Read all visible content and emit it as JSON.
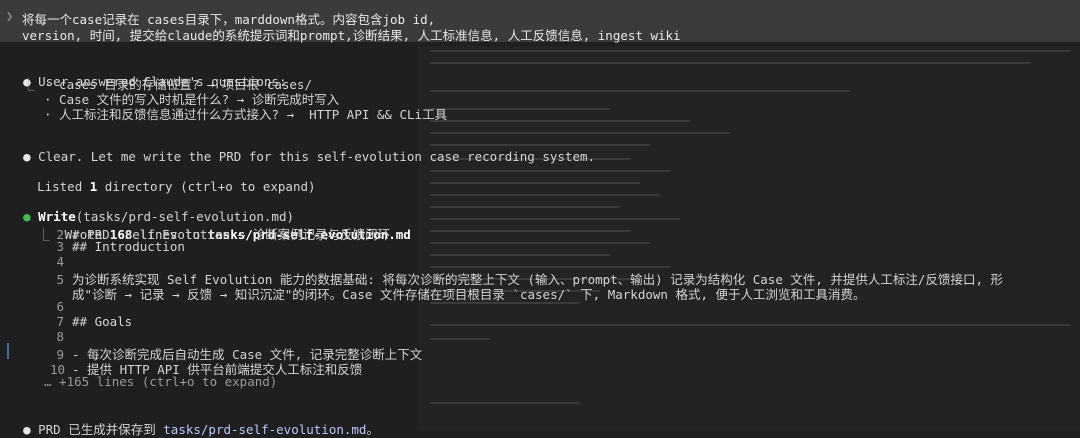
{
  "prompt": {
    "line1": "将每一个case记录在 cases目录下，marddown格式。内容包含job id,",
    "line2": "version, 时间, 提交给claude的系统提示词和prompt,诊断结果, 人工标准信息, 人工反馈信息, ingest wiki"
  },
  "questions": {
    "header": "User answered Claude's questions:",
    "items": [
      "· cases 目录的存储位置? → 项目根 cases/",
      "· Case 文件的写入时机是什么? → 诊断完成时写入",
      "· 人工标注和反馈信息通过什么方式接入? →  HTTP API && CLi工具"
    ]
  },
  "clear_msg": "Clear. Let me write the PRD for this self-evolution case recording system.",
  "listed": {
    "prefix": "Listed ",
    "count": "1",
    "suffix": " directory (ctrl+o to expand)"
  },
  "write": {
    "tool": "Write",
    "arg": "(tasks/prd-self-evolution.md)",
    "result_prefix": "Wrote ",
    "result_count": "168",
    "result_mid": " lines to ",
    "result_path": "tasks/prd-self-evolution.md"
  },
  "file_lines": [
    {
      "n": "2",
      "text": "# PRD: Self Evolution — 诊断案例记录与反馈闭环"
    },
    {
      "n": "3",
      "text": "## Introduction"
    },
    {
      "n": "4",
      "text": ""
    },
    {
      "n": "5",
      "text": "为诊断系统实现 Self Evolution 能力的数据基础: 将每次诊断的完整上下文 (输入、prompt、输出) 记录为结构化 Case 文件, 并提供人工标注/反馈接口, 形"
    },
    {
      "n": "",
      "text": "成\"诊断 → 记录 → 反馈 → 知识沉淀\"的闭环。Case 文件存储在项目根目录 `cases/` 下, Markdown 格式, 便于人工浏览和工具消费。"
    },
    {
      "n": "6",
      "text": ""
    },
    {
      "n": "7",
      "text": "## Goals"
    },
    {
      "n": "8",
      "text": ""
    },
    {
      "n": "9",
      "text": "- 每次诊断完成后自动生成 Case 文件, 记录完整诊断上下文"
    },
    {
      "n": "10",
      "text": "- 提供 HTTP API 供平台前端提交人工标注和反馈"
    }
  ],
  "more_lines": "… +165 lines (ctrl+o to expand)",
  "final": {
    "prefix": "PRD 已生成并保存到 ",
    "path": "tasks/prd-self-evolution.md",
    "suffix": "。"
  },
  "colors": {
    "background": "#1f1f1f",
    "prompt_bg": "#3b3b3b",
    "bullet_green": "#3fbf4e",
    "link": "#b9c6ff"
  }
}
